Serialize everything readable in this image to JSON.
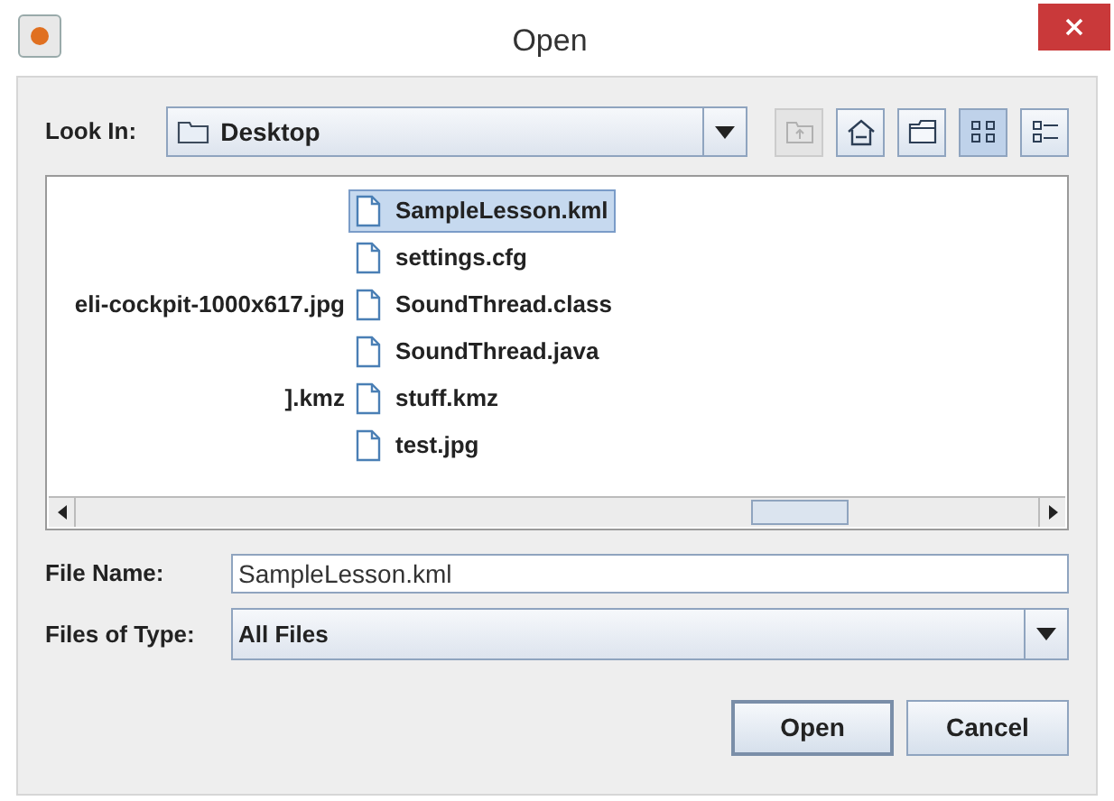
{
  "window": {
    "title": "Open"
  },
  "look_in": {
    "label": "Look In:",
    "value": "Desktop"
  },
  "toolbar": [
    {
      "kind": "up",
      "disabled": true,
      "selected": false
    },
    {
      "kind": "home",
      "disabled": false,
      "selected": false
    },
    {
      "kind": "new-folder",
      "disabled": false,
      "selected": false
    },
    {
      "kind": "list",
      "disabled": false,
      "selected": true
    },
    {
      "kind": "details",
      "disabled": false,
      "selected": false
    }
  ],
  "file_list": {
    "rows": [
      {
        "file": {
          "name": "SampleLesson.kml",
          "selected": true
        }
      },
      {
        "file": {
          "name": "settings.cfg",
          "selected": false
        }
      },
      {
        "cut_name": "eli-cockpit-1000x617.jpg",
        "file": {
          "name": "SoundThread.class",
          "selected": false
        }
      },
      {
        "file": {
          "name": "SoundThread.java",
          "selected": false
        }
      },
      {
        "cut_name": "].kmz",
        "file": {
          "name": "stuff.kmz",
          "selected": false
        }
      },
      {
        "file": {
          "name": "test.jpg",
          "selected": false
        }
      }
    ]
  },
  "file_name": {
    "label": "File Name:",
    "value": "SampleLesson.kml"
  },
  "file_type": {
    "label": "Files of Type:",
    "value": "All Files"
  },
  "buttons": [
    {
      "label": "Open",
      "kind": "default"
    },
    {
      "label": "Cancel",
      "kind": "normal"
    }
  ]
}
